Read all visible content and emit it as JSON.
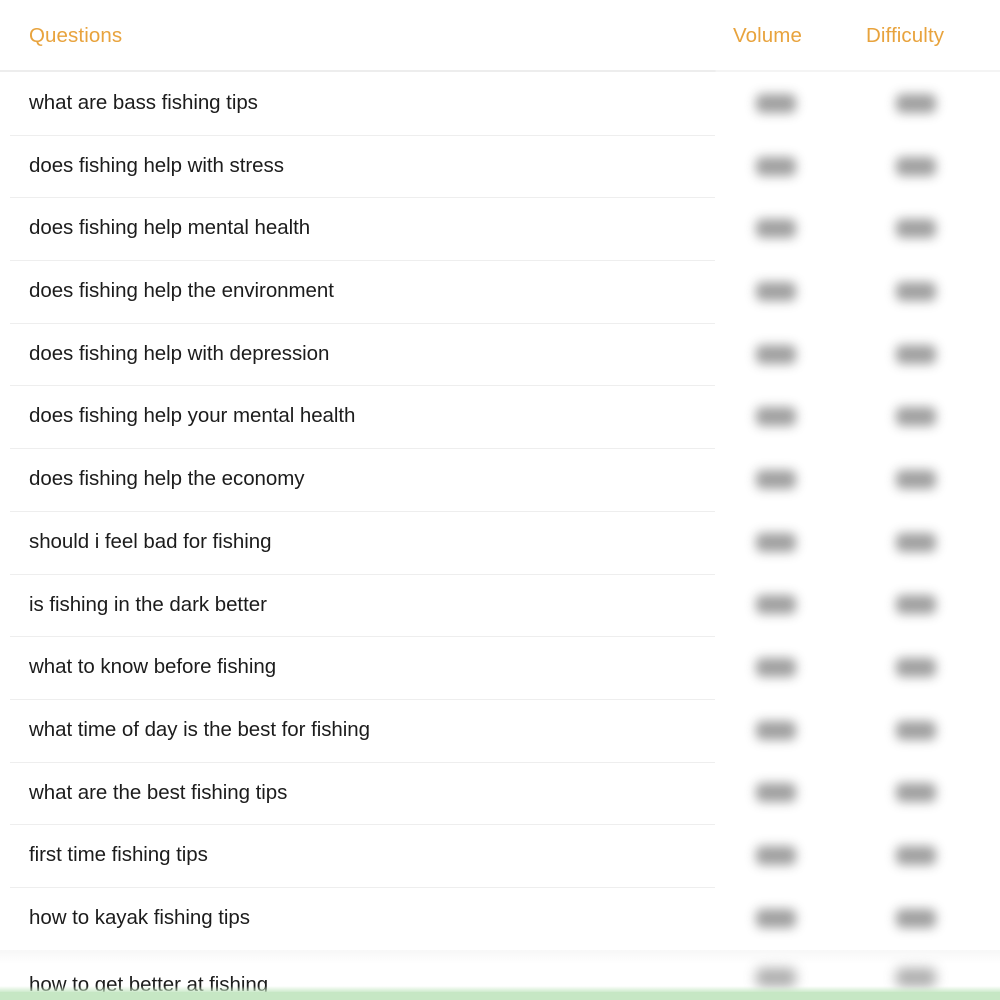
{
  "table": {
    "columns": {
      "questions": "Questions",
      "volume": "Volume",
      "difficulty": "Difficulty"
    },
    "accent_color": "#e8a33d",
    "text_color": "#1c1c1c",
    "divider_color": "#eeeeee",
    "bottom_strip_color": "#c6e7c4",
    "metric_state": "blurred",
    "rows": [
      {
        "question": "what are bass fishing tips",
        "volume": "",
        "difficulty": ""
      },
      {
        "question": "does fishing help with stress",
        "volume": "",
        "difficulty": ""
      },
      {
        "question": "does fishing help mental health",
        "volume": "",
        "difficulty": ""
      },
      {
        "question": "does fishing help the environment",
        "volume": "",
        "difficulty": ""
      },
      {
        "question": "does fishing help with depression",
        "volume": "",
        "difficulty": ""
      },
      {
        "question": "does fishing help your mental health",
        "volume": "",
        "difficulty": ""
      },
      {
        "question": "does fishing help the economy",
        "volume": "",
        "difficulty": ""
      },
      {
        "question": "should i feel bad for fishing",
        "volume": "",
        "difficulty": ""
      },
      {
        "question": "is fishing in the dark better",
        "volume": "",
        "difficulty": ""
      },
      {
        "question": "what to know before fishing",
        "volume": "",
        "difficulty": ""
      },
      {
        "question": "what time of day is the best for fishing",
        "volume": "",
        "difficulty": ""
      },
      {
        "question": "what are the best fishing tips",
        "volume": "",
        "difficulty": ""
      },
      {
        "question": "first time fishing tips",
        "volume": "",
        "difficulty": ""
      },
      {
        "question": "how to kayak fishing tips",
        "volume": "",
        "difficulty": ""
      },
      {
        "question": "how to get better at fishing",
        "volume": "",
        "difficulty": ""
      }
    ]
  }
}
